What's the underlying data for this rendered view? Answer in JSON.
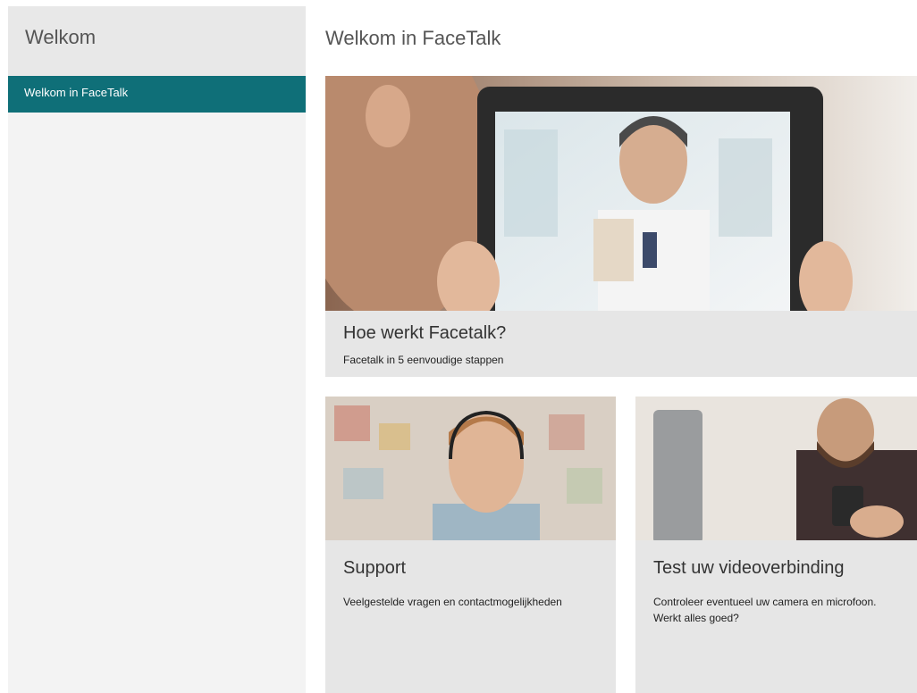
{
  "sidebar": {
    "header": "Welkom",
    "items": [
      {
        "label": "Welkom in FaceTalk"
      }
    ]
  },
  "main": {
    "title": "Welkom in FaceTalk",
    "cards": {
      "hero": {
        "title": "Hoe werkt Facetalk?",
        "description": "Facetalk in 5 eenvoudige stappen"
      },
      "support": {
        "title": "Support",
        "description": "Veelgestelde vragen en contactmogelijkheden"
      },
      "test": {
        "title": "Test uw videoverbinding",
        "description": "Controleer eventueel uw camera en microfoon. Werkt alles goed?"
      }
    }
  },
  "colors": {
    "accent": "#0f6f78",
    "sidebar_bg": "#f3f3f3",
    "card_bg": "#e6e6e6"
  }
}
